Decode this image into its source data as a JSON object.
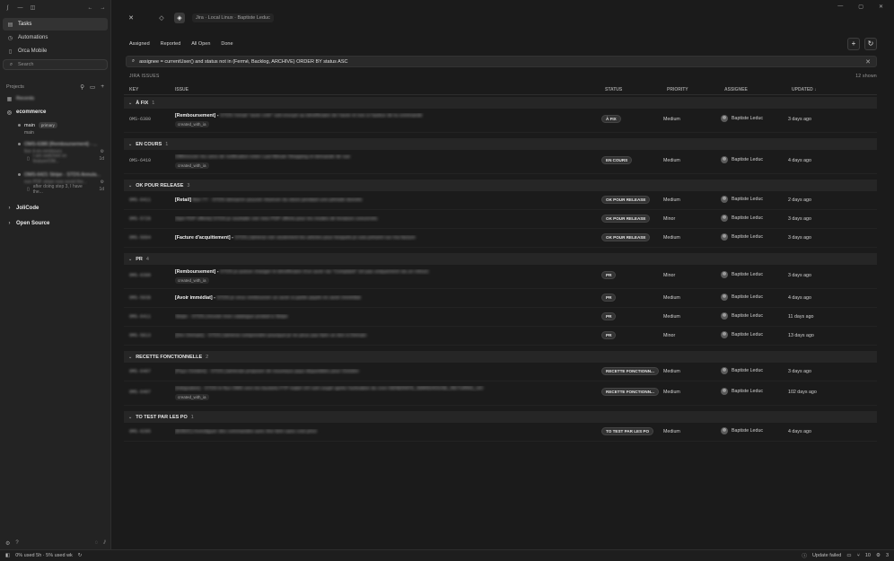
{
  "sidebar": {
    "nav": [
      "Tasks",
      "Automations",
      "Orca Mobile"
    ],
    "search_placeholder": "Search",
    "projects_label": "Projects",
    "recents": "Recents",
    "project_name": "ecommerce",
    "branch": "main",
    "branch_badge": "primary",
    "branch_sub": "main",
    "wt1_title": "OMS-6380 [Remboursement] - ...",
    "wt1_sub": "fixe 4-en-rembours",
    "wt1_detail": "I am switched on feature/OM...",
    "wt1_age": "1d",
    "wt2_title": "OMS-6421 Stripe - STDS Annula...",
    "wt2_sub": "non PDF stripe now avoid the...",
    "wt2_detail": "after doing step 3, I have the...",
    "wt2_age": "1d",
    "sections": [
      "JoliCode",
      "Open Source"
    ]
  },
  "statusbar": {
    "usage": "0% used 5h · 5% used wk",
    "update": "Update failed",
    "right1": "10",
    "right2": "3"
  },
  "topbar": {
    "crumb": "Jira · Local Linux · Baptiste Leduc"
  },
  "tabs": [
    "Assigned",
    "Reported",
    "All Open",
    "Done"
  ],
  "jql": "assignee = currentUser() and status not in (Fermé, Backlog, ARCHIVE) ORDER BY status ASC",
  "issues_header": {
    "title": "JIRA ISSUES",
    "count": "12 shown"
  },
  "columns": {
    "key": "KEY",
    "issue": "ISSUE",
    "status": "STATUS",
    "priority": "PRIORITY",
    "assignee": "ASSIGNEE",
    "updated": "UPDATED ↓"
  },
  "groups": [
    {
      "name": "À FIX",
      "count": "1",
      "rows": [
        {
          "key": "OMS-6380",
          "bold": "[Remboursement] -",
          "rest": "STDS l'email \"avoir créé\" soit envoyé au bénéficiaire de l'avoir et non à l'auteur de la commande",
          "label": "created_with_ia",
          "status": "À FIX",
          "priority": "Medium",
          "assignee": "Baptiste Leduc",
          "updated": "3 days ago"
        }
      ]
    },
    {
      "name": "EN COURS",
      "count": "1",
      "rows": [
        {
          "key": "OMS-6410",
          "bold": "",
          "rest": "Différencier les sens de notification entre Last Minute Shopping et demande de vue",
          "label": "created_with_ia",
          "status": "EN COURS",
          "priority": "Medium",
          "assignee": "Baptiste Leduc",
          "updated": "4 days ago"
        }
      ]
    },
    {
      "name": "OK POUR RELEASE",
      "count": "3",
      "rows": [
        {
          "key": "OMS-6411",
          "bold": "[Retail]",
          "rest": "Bon TT - STDS demarrer pouvoir réserver du stock pendant une période donnée",
          "label": "",
          "status": "OK POUR RELEASE",
          "priority": "Medium",
          "assignee": "Baptiste Leduc",
          "updated": "2 days ago"
        },
        {
          "key": "OMS-5728",
          "bold": "",
          "rest": "[Spé PDP offerte] STDS je souhaite voir mes PDP offerts pour les modes de livraison concernés",
          "label": "",
          "status": "OK POUR RELEASE",
          "priority": "Minor",
          "assignee": "Baptiste Leduc",
          "updated": "3 days ago"
        },
        {
          "key": "OMS-5094",
          "bold": "[Facture d'acquittement] -",
          "rest": "STDS j'aimerai voir seulement les articles pour lesquels je suis présent sur ma facture",
          "label": "",
          "status": "OK POUR RELEASE",
          "priority": "Medium",
          "assignee": "Baptiste Leduc",
          "updated": "3 days ago"
        }
      ]
    },
    {
      "name": "PR",
      "count": "4",
      "rows": [
        {
          "key": "OMS-6390",
          "bold": "[Remboursement] -",
          "rest": "STDS je puisse changer le bénéficiaire d'un avoir via \"Complaint\" (et pas uniquement via un retour)",
          "label": "created_with_ia",
          "status": "PR",
          "priority": "Minor",
          "assignee": "Baptiste Leduc",
          "updated": "3 days ago"
        },
        {
          "key": "OMS-5938",
          "bold": "[Avoir immédiat] -",
          "rest": "STDS je veux rembourser un avoir si partie payée en avoir immédiat",
          "label": "",
          "status": "PR",
          "priority": "Medium",
          "assignee": "Baptiste Leduc",
          "updated": "4 days ago"
        },
        {
          "key": "OMS-6411",
          "bold": "",
          "rest": "Stripe - STDS j'envoie mon catalogue produit à Stripe",
          "label": "",
          "status": "PR",
          "priority": "Medium",
          "assignee": "Baptiste Leduc",
          "updated": "11 days ago"
        },
        {
          "key": "OMS-5813",
          "bold": "",
          "rest": "[Dev Demain] - STDS j'aimerai comprendre pourquoi je ne peux pas faire un don à Demain",
          "label": "",
          "status": "PR",
          "priority": "Minor",
          "assignee": "Baptiste Leduc",
          "updated": "13 days ago"
        }
      ]
    },
    {
      "name": "RECETTE FONCTIONNELLE",
      "count": "2",
      "rows": [
        {
          "key": "OMS-6407",
          "bold": "",
          "rest": "[Pays Octobre] - STDS j'aimerais proposer de nouveaux pays disponibles pour Octobre",
          "label": "",
          "status": "RECETTE FONCTIONN...",
          "priority": "Medium",
          "assignee": "Baptiste Leduc",
          "updated": "3 days ago"
        },
        {
          "key": "OMS-6407",
          "bold": "",
          "rest": "[Intégration] - STDS le flux OMS vers les buckets FTP mabé UO soit coupé après l'activation du cron GENERATE_WAREHOUSE_RETURNS_UO",
          "label": "created_with_ia",
          "status": "RECETTE FONCTIONN...",
          "priority": "Medium",
          "assignee": "Baptiste Leduc",
          "updated": "102 days ago"
        }
      ]
    },
    {
      "name": "TO TEST PAR LES PO",
      "count": "1",
      "rows": [
        {
          "key": "OMS-6285",
          "bold": "",
          "rest": "[B2B2C] Investiguer des commandes avec line item sans cost price",
          "label": "",
          "status": "TO TEST PAR LES PO",
          "priority": "Medium",
          "assignee": "Baptiste Leduc",
          "updated": "4 days ago"
        }
      ]
    }
  ]
}
